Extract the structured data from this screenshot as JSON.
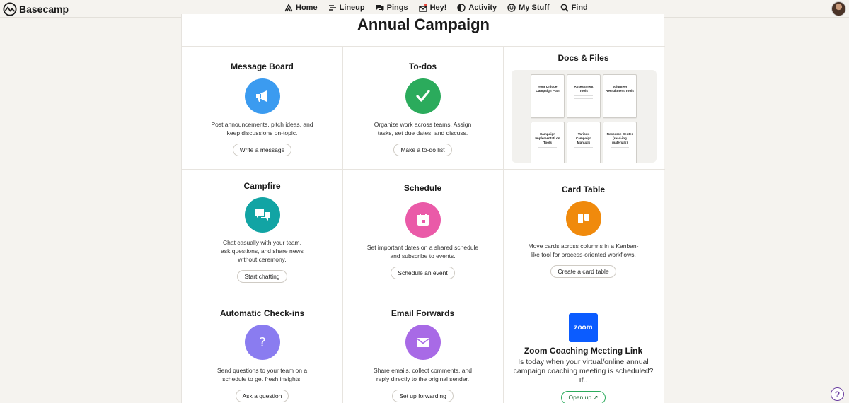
{
  "app": {
    "name": "Basecamp"
  },
  "nav": {
    "items": [
      {
        "label": "Home",
        "icon": "home-icon"
      },
      {
        "label": "Lineup",
        "icon": "lineup-icon"
      },
      {
        "label": "Pings",
        "icon": "pings-icon"
      },
      {
        "label": "Hey!",
        "icon": "hey-icon"
      },
      {
        "label": "Activity",
        "icon": "activity-icon"
      },
      {
        "label": "My Stuff",
        "icon": "my-stuff-icon"
      },
      {
        "label": "Find",
        "icon": "search-icon"
      }
    ]
  },
  "project": {
    "title": "Annual Campaign"
  },
  "tools": {
    "message_board": {
      "title": "Message Board",
      "desc": "Post announcements, pitch ideas, and keep discussions on-topic.",
      "button": "Write a message",
      "color": "#3b9bf0"
    },
    "todos": {
      "title": "To-dos",
      "desc": "Organize work across teams. Assign tasks, set due dates, and discuss.",
      "button": "Make a to-do list",
      "color": "#2bab5c"
    },
    "docs": {
      "title": "Docs & Files",
      "files": [
        "Your Unique Campaign Plan",
        "Assessment Tools",
        "Volunteer Recruitment Tools",
        "Campaign Implementati on Tools",
        "Various Campaign Manuals",
        "Resource Center (read-ing materials)"
      ]
    },
    "campfire": {
      "title": "Campfire",
      "desc": "Chat casually with your team, ask questions, and share news without ceremony.",
      "button": "Start chatting",
      "color": "#12a4a4"
    },
    "schedule": {
      "title": "Schedule",
      "desc": "Set important dates on a shared schedule and subscribe to events.",
      "button": "Schedule an event",
      "color": "#ea5aa8"
    },
    "card_table": {
      "title": "Card Table",
      "desc": "Move cards across columns in a Kanban-like tool for process-oriented workflows.",
      "button": "Create a card table",
      "color": "#f08a0c"
    },
    "checkins": {
      "title": "Automatic Check-ins",
      "desc": "Send questions to your team on a schedule to get fresh insights.",
      "button": "Ask a question",
      "color": "#8a7cf0"
    },
    "email_forwards": {
      "title": "Email Forwards",
      "desc": "Share emails, collect comments, and reply directly to the original sender.",
      "button": "Set up forwarding",
      "color": "#a86ae6"
    },
    "zoom": {
      "logo_text": "zoom",
      "title": "Zoom Coaching Meeting Link",
      "desc": "Is today when your virtual/online annual campaign coaching meeting is scheduled? If..",
      "button": "Open up ↗",
      "color": "#0b5cff"
    }
  },
  "help": {
    "label": "?"
  }
}
